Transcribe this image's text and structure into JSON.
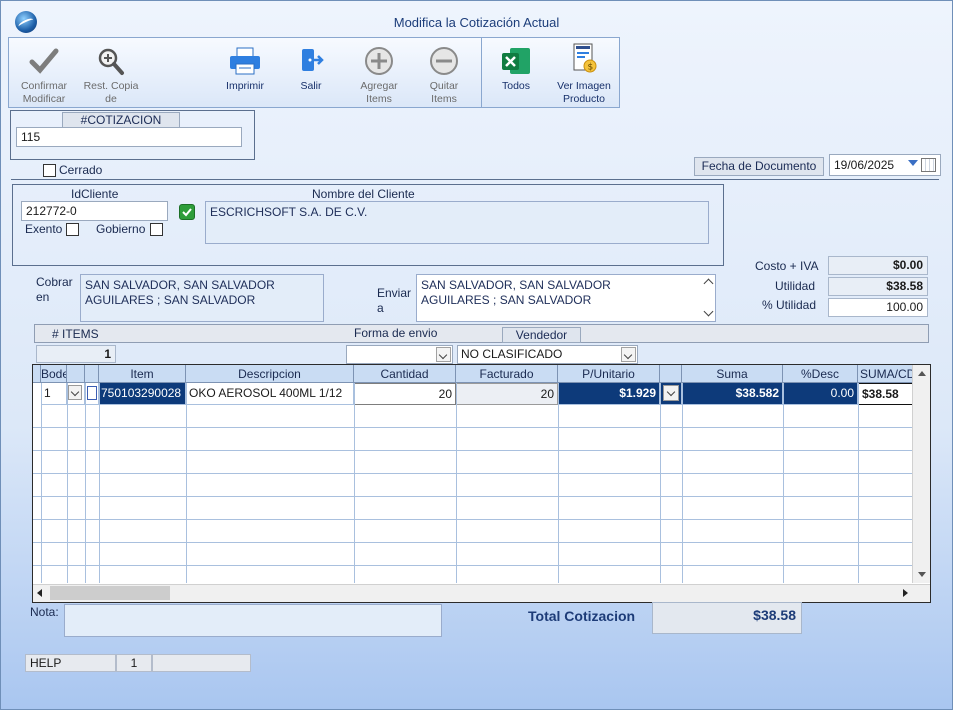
{
  "window": {
    "title": "Modifica la Cotización Actual"
  },
  "toolbar": {
    "confirm": {
      "line1": "Confirmar",
      "line2": "Modificar"
    },
    "restore": {
      "line1": "Rest. Copia",
      "line2": "de"
    },
    "print": "Imprimir",
    "exit": "Salir",
    "add": {
      "line1": "Agregar",
      "line2": "Items"
    },
    "remove": {
      "line1": "Quitar",
      "line2": "Items"
    },
    "all": "Todos",
    "view_image": {
      "line1": "Ver Imagen",
      "line2": "Producto"
    }
  },
  "quote": {
    "header": "#COTIZACION",
    "number": "115",
    "closed_label": "Cerrado"
  },
  "document_date": {
    "label": "Fecha de  Documento",
    "value": "19/06/2025"
  },
  "client": {
    "id_label": "IdCliente",
    "id_value": "212772-0",
    "name_label": "Nombre del Cliente",
    "name_value": "ESCRICHSOFT S.A. DE C.V.",
    "exento_label": "Exento",
    "gobierno_label": "Gobierno"
  },
  "addresses": {
    "cobrar_label1": "Cobrar",
    "cobrar_label2": "en",
    "cobrar_line1": "SAN SALVADOR, SAN SALVADOR",
    "cobrar_line2": "AGUILARES ; SAN SALVADOR",
    "enviar_label1": "Enviar",
    "enviar_label2": "a",
    "enviar_line1": "SAN SALVADOR, SAN SALVADOR",
    "enviar_line2": "AGUILARES ; SAN SALVADOR"
  },
  "totals_side": {
    "costo_label": "Costo + IVA",
    "costo_value": "$0.00",
    "utilidad_label": "Utilidad",
    "utilidad_value": "$38.58",
    "pct_label": "% Utilidad",
    "pct_value": "100.00"
  },
  "items_bar": {
    "items_label": "# ITEMS",
    "items_value": "1",
    "envio_label": "Forma de envio",
    "envio_value": "",
    "vendedor_label": "Vendedor",
    "vendedor_value": "NO CLASIFICADO"
  },
  "grid": {
    "headers": [
      "Bodega",
      "",
      "Item",
      "Descripcion",
      "Cantidad",
      "Facturado",
      "P/Unitario",
      "",
      "Suma",
      "%Desc",
      "SUMA/CD"
    ],
    "row": {
      "bodega": "1",
      "item": "750103290028",
      "descripcion": "OKO AEROSOL  400ML 1/12",
      "cantidad": "20",
      "facturado": "20",
      "punitario": "$1.929",
      "suma": "$38.582",
      "desc": "0.00",
      "sumacd": "$38.58"
    }
  },
  "footer": {
    "nota_label": "Nota:",
    "nota_value": "",
    "total_label": "Total Cotizacion",
    "total_value": "$38.58"
  },
  "status": {
    "help": "HELP",
    "page": "1",
    "extra": ""
  }
}
